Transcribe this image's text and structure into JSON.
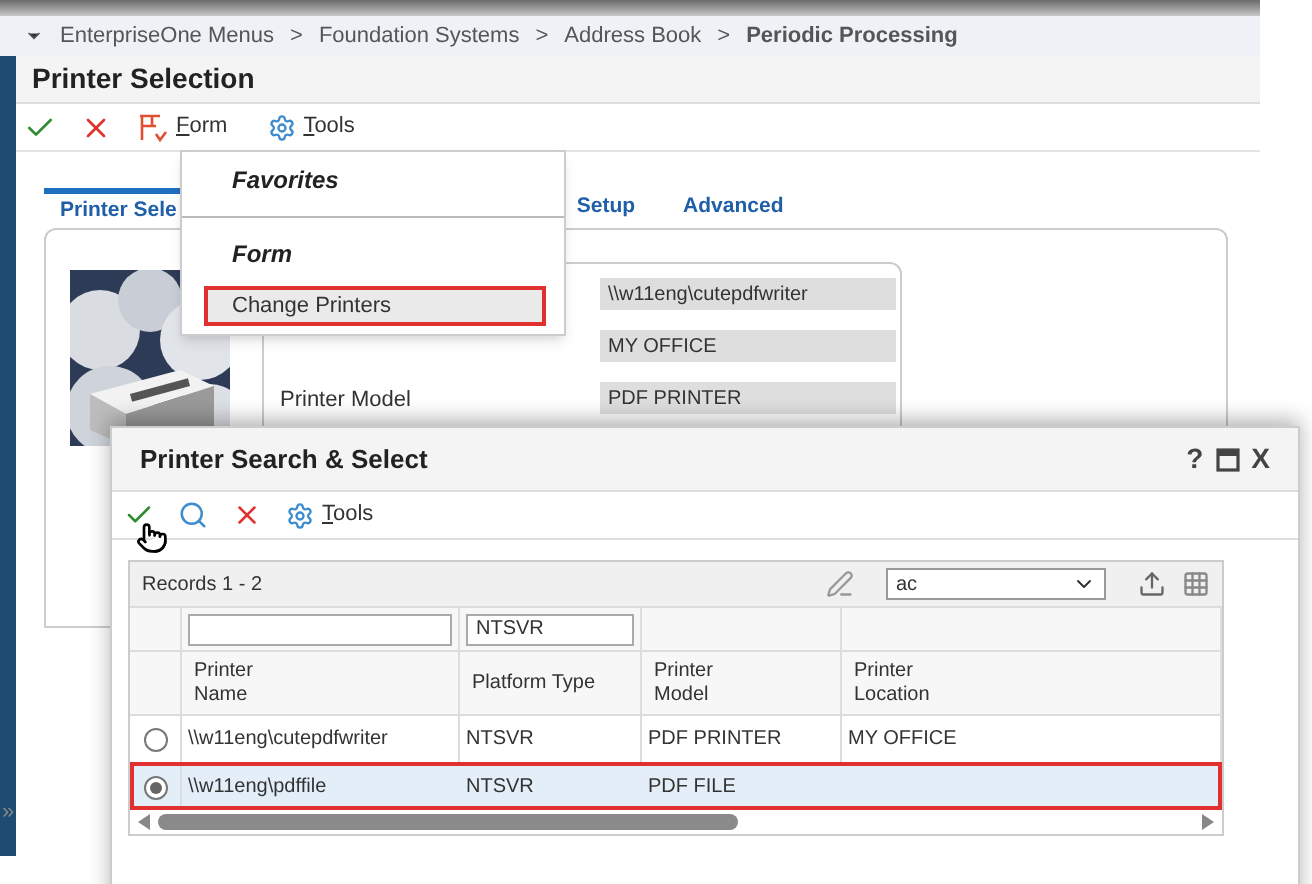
{
  "breadcrumb": [
    {
      "kind": "link",
      "text": "EnterpriseOne Menus"
    },
    {
      "kind": "separator",
      "text": ">"
    },
    {
      "kind": "link",
      "text": "Foundation Systems"
    },
    {
      "kind": "separator",
      "text": ">"
    },
    {
      "kind": "link",
      "text": "Address Book"
    },
    {
      "kind": "separator",
      "text": ">"
    },
    {
      "kind": "current",
      "text": "Periodic Processing"
    }
  ],
  "form": {
    "title": "Printer Selection",
    "menu_label": "Form",
    "tools_label": "Tools",
    "tabs": [
      {
        "label": "Printer Sele",
        "selected": true
      },
      {
        "label": "Setup",
        "selected": false
      },
      {
        "label": "Advanced",
        "selected": false
      }
    ],
    "fields": [
      {
        "value": "\\\\w11eng\\cutepdfwriter"
      },
      {
        "value": "MY OFFICE"
      },
      {
        "label": "Printer Model",
        "value": "PDF PRINTER"
      }
    ],
    "collapse_glyph": "»"
  },
  "form_menu": {
    "sections": [
      {
        "heading": "Favorites"
      },
      {
        "heading": "Form",
        "items": [
          {
            "label": "Change Printers",
            "highlighted": true
          }
        ]
      }
    ]
  },
  "dialog": {
    "title": "Printer Search & Select",
    "help": "?",
    "close": "X",
    "tools_label": "Tools",
    "records": "Records 1 - 2",
    "view": "ac",
    "columns": [
      {
        "label": "Printer Name",
        "filter_field": true
      },
      {
        "label": "Platform Type",
        "filter_field": true,
        "filter": "NTSVR"
      },
      {
        "label": "Printer Model",
        "filter_field": false
      },
      {
        "label": "Printer Location",
        "filter_field": false
      }
    ],
    "rows": [
      {
        "selected": false,
        "highlighted": false,
        "cells": [
          "\\\\w11eng\\cutepdfwriter",
          "NTSVR",
          "PDF PRINTER",
          "MY OFFICE"
        ]
      },
      {
        "selected": true,
        "highlighted": true,
        "cells": [
          "\\\\w11eng\\pdffile",
          "NTSVR",
          "PDF FILE"
        ]
      }
    ]
  }
}
